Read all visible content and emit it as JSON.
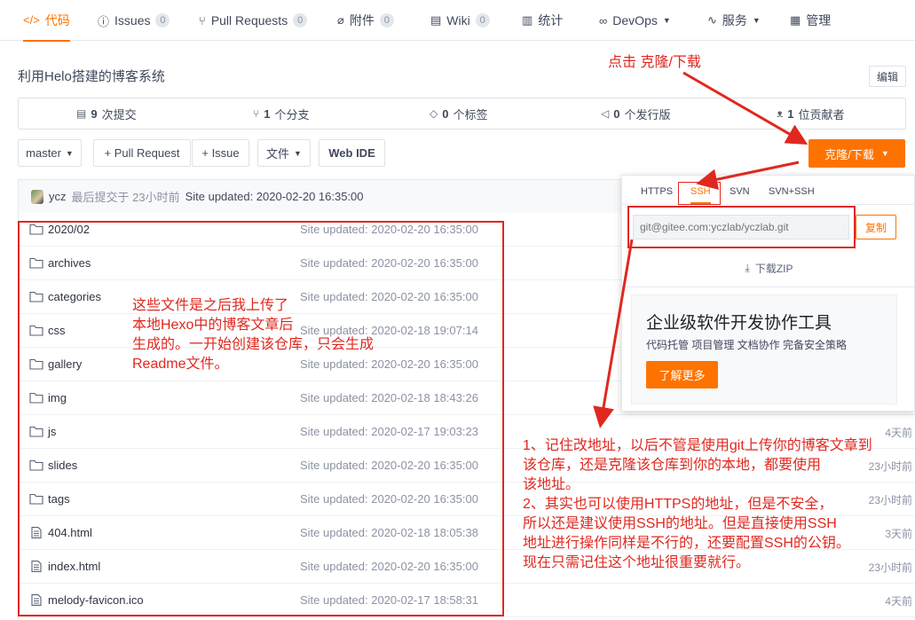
{
  "nav": {
    "tabs": [
      {
        "label": "代码",
        "icon": "code-icon",
        "glyph": "</>",
        "count": null
      },
      {
        "label": "Issues",
        "icon": "issue-icon",
        "glyph": "ⓘ",
        "count": "0"
      },
      {
        "label": "Pull Requests",
        "icon": "pull-request-icon",
        "glyph": "⑂",
        "count": "0"
      },
      {
        "label": "附件",
        "icon": "paperclip-icon",
        "glyph": "⌀",
        "count": "0"
      },
      {
        "label": "Wiki",
        "icon": "wiki-icon",
        "glyph": "▤",
        "count": "0"
      },
      {
        "label": "统计",
        "icon": "stats-icon",
        "glyph": "▥",
        "count": null
      },
      {
        "label": "DevOps",
        "icon": "devops-icon",
        "glyph": "∞",
        "count": null
      },
      {
        "label": "服务",
        "icon": "service-icon",
        "glyph": "∿",
        "count": null
      },
      {
        "label": "管理",
        "icon": "manage-icon",
        "glyph": "▦",
        "count": null
      }
    ]
  },
  "repo": {
    "description": "利用Helo搭建的博客系统",
    "edit_label": "编辑"
  },
  "stats": {
    "commits": {
      "count": "9",
      "label": "次提交"
    },
    "branches": {
      "count": "1",
      "label": "个分支"
    },
    "tags": {
      "count": "0",
      "label": "个标签"
    },
    "releases": {
      "count": "0",
      "label": "个发行版"
    },
    "contributors": {
      "count": "1",
      "label": "位贡献者"
    }
  },
  "toolbar": {
    "branch": "master",
    "pull_request": "+ Pull Request",
    "issue": "+ Issue",
    "file": "文件",
    "web_ide": "Web IDE",
    "clone": "克隆/下载"
  },
  "commit": {
    "user": "ycz",
    "time": "最后提交于 23小时前",
    "message": "Site updated: 2020-02-20 16:35:00"
  },
  "files": [
    {
      "name": "2020/02",
      "type": "folder",
      "message": "Site updated: 2020-02-20 16:35:00",
      "age": ""
    },
    {
      "name": "archives",
      "type": "folder",
      "message": "Site updated: 2020-02-20 16:35:00",
      "age": ""
    },
    {
      "name": "categories",
      "type": "folder",
      "message": "Site updated: 2020-02-20 16:35:00",
      "age": ""
    },
    {
      "name": "css",
      "type": "folder",
      "message": "Site updated: 2020-02-18 19:07:14",
      "age": ""
    },
    {
      "name": "gallery",
      "type": "folder",
      "message": "Site updated: 2020-02-20 16:35:00",
      "age": ""
    },
    {
      "name": "img",
      "type": "folder",
      "message": "Site updated: 2020-02-18 18:43:26",
      "age": ""
    },
    {
      "name": "js",
      "type": "folder",
      "message": "Site updated: 2020-02-17 19:03:23",
      "age": "4天前"
    },
    {
      "name": "slides",
      "type": "folder",
      "message": "Site updated: 2020-02-20 16:35:00",
      "age": "23小时前"
    },
    {
      "name": "tags",
      "type": "folder",
      "message": "Site updated: 2020-02-20 16:35:00",
      "age": "23小时前"
    },
    {
      "name": "404.html",
      "type": "file",
      "message": "Site updated: 2020-02-18 18:05:38",
      "age": "3天前"
    },
    {
      "name": "index.html",
      "type": "file",
      "message": "Site updated: 2020-02-20 16:35:00",
      "age": "23小时前"
    },
    {
      "name": "melody-favicon.ico",
      "type": "file",
      "message": "Site updated: 2020-02-17 18:58:31",
      "age": "4天前"
    }
  ],
  "clone_panel": {
    "protocols": [
      "HTTPS",
      "SSH",
      "SVN",
      "SVN+SSH"
    ],
    "active_protocol": "SSH",
    "url": "git@gitee.com:yczlab/yczlab.git",
    "copy_label": "复制",
    "download_label": "下载ZIP",
    "promo_title": "企业级软件开发协作工具",
    "promo_sub": "代码托管 项目管理 文档协作 完备安全策略",
    "promo_button": "了解更多"
  },
  "annotations": {
    "click_hint": "点击 克隆/下载",
    "files_note": "这些文件是之后我上传了\n本地Hexo中的博客文章后\n生成的。一开始创建该仓库，只会生成\nReadme文件。",
    "address_note": "1、记住改地址，以后不管是使用git上传你的博客文章到\n该仓库，还是克隆该仓库到你的本地，都要使用\n该地址。\n2、其实也可以使用HTTPS的地址，但是不安全，\n所以还是建议使用SSH的地址。但是直接使用SSH\n地址进行操作同样是不行的，还要配置SSH的公钥。\n现在只需记住这个地址很重要就行。"
  },
  "colors": {
    "accent": "#fe7300",
    "annotation_red": "#e0281f"
  }
}
